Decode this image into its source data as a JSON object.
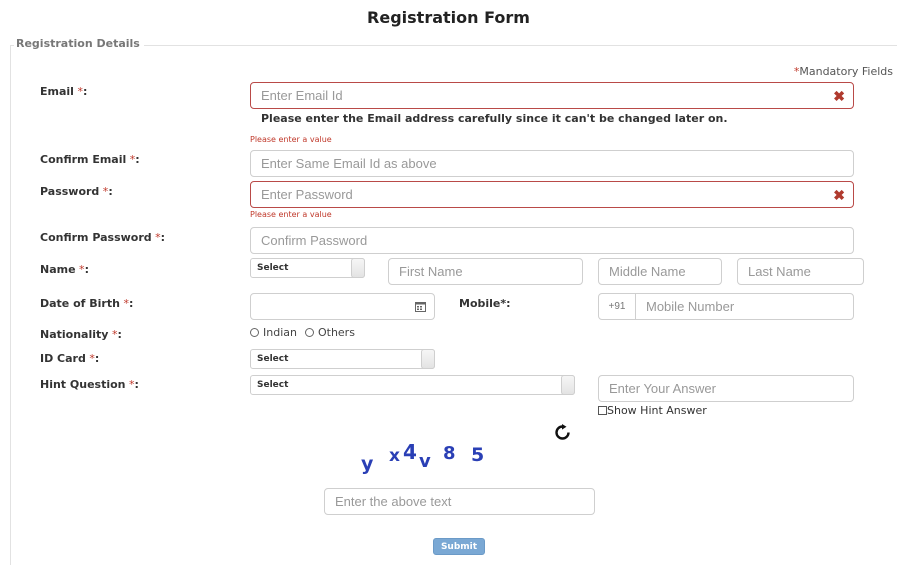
{
  "page": {
    "title": "Registration Form"
  },
  "section": {
    "legend": "Registration Details",
    "mandatory_star": "*",
    "mandatory_text": "Mandatory Fields"
  },
  "labels": {
    "email": "Email",
    "confirm_email": "Confirm Email",
    "password": "Password",
    "confirm_password": "Confirm Password",
    "name": "Name",
    "dob": "Date of Birth",
    "mobile": "Mobile*:",
    "nationality": "Nationality",
    "id_card": "ID Card",
    "hint_question": "Hint Question",
    "req_suffix": " *",
    "colon": ":"
  },
  "fields": {
    "email": {
      "placeholder": "Enter Email Id",
      "value": ""
    },
    "confirm_email": {
      "placeholder": "Enter Same Email Id as above",
      "value": ""
    },
    "password": {
      "placeholder": "Enter Password",
      "value": ""
    },
    "confirm_password": {
      "placeholder": "Confirm Password",
      "value": ""
    },
    "first_name": {
      "placeholder": "First Name"
    },
    "middle_name": {
      "placeholder": "Middle Name"
    },
    "last_name": {
      "placeholder": "Last Name"
    },
    "dob": {
      "value": ""
    },
    "mobile_prefix": "+91",
    "mobile": {
      "placeholder": "Mobile Number"
    },
    "hint_answer": {
      "placeholder": "Enter Your Answer"
    },
    "captcha_input": {
      "placeholder": "Enter the above text"
    }
  },
  "selects": {
    "title": "Select",
    "id_card": "Select",
    "hint_question": "Select"
  },
  "messages": {
    "email_note": "Please enter the Email address carefully since it can't be changed later on.",
    "email_error": "Please enter a value",
    "password_error": "Please enter a value"
  },
  "nationality_options": [
    "Indian",
    "Others"
  ],
  "show_hint_label": "Show Hint Answer",
  "captcha": {
    "chars": [
      "y",
      "x",
      "4",
      "v",
      "8",
      "5"
    ],
    "color": "#2a3fb5"
  },
  "icons": {
    "clear": "close-icon",
    "calendar": "calendar-icon",
    "refresh": "refresh-icon"
  },
  "colors": {
    "error": "#c0392b",
    "submit_bg": "#7aa8d4"
  },
  "submit_label": "Submit"
}
